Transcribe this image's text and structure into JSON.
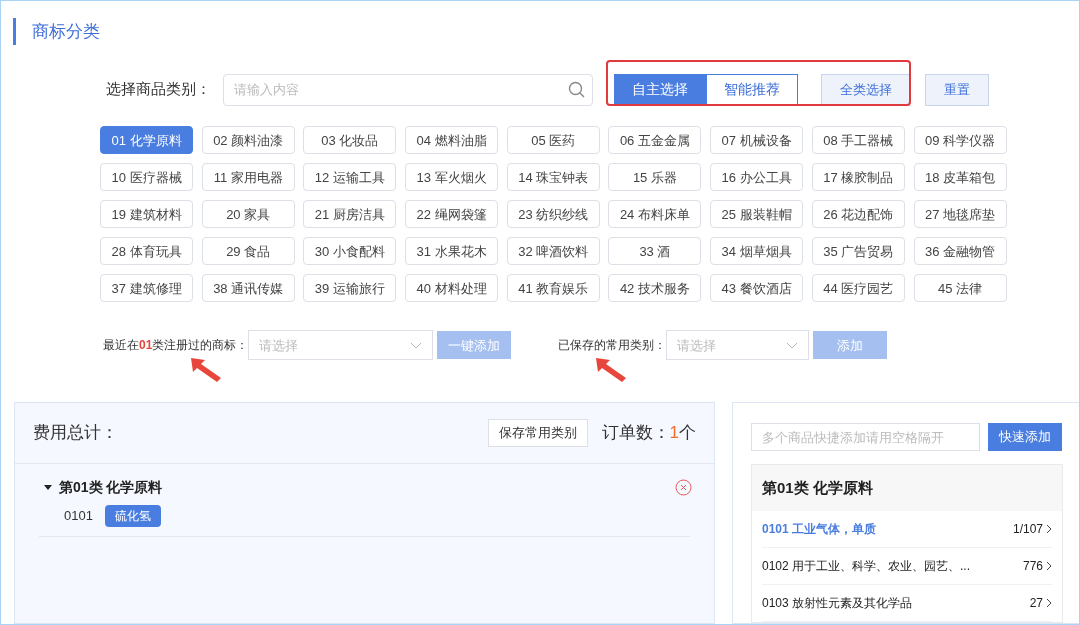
{
  "title": "商标分类",
  "search": {
    "label": "选择商品类别：",
    "placeholder": "请输入内容"
  },
  "modes": [
    {
      "label": "自主选择",
      "selected": true
    },
    {
      "label": "智能推荐",
      "selected": false
    }
  ],
  "actions": [
    "全类选择",
    "重置"
  ],
  "categories": [
    {
      "label": "01 化学原料",
      "selected": true
    },
    {
      "label": "02 颜料油漆",
      "selected": false
    },
    {
      "label": "03 化妆品",
      "selected": false
    },
    {
      "label": "04 燃料油脂",
      "selected": false
    },
    {
      "label": "05 医药",
      "selected": false
    },
    {
      "label": "06 五金金属",
      "selected": false
    },
    {
      "label": "07 机械设备",
      "selected": false
    },
    {
      "label": "08 手工器械",
      "selected": false
    },
    {
      "label": "09 科学仪器",
      "selected": false
    },
    {
      "label": "10 医疗器械",
      "selected": false
    },
    {
      "label": "11 家用电器",
      "selected": false
    },
    {
      "label": "12 运输工具",
      "selected": false
    },
    {
      "label": "13 军火烟火",
      "selected": false
    },
    {
      "label": "14 珠宝钟表",
      "selected": false
    },
    {
      "label": "15 乐器",
      "selected": false
    },
    {
      "label": "16 办公工具",
      "selected": false
    },
    {
      "label": "17 橡胶制品",
      "selected": false
    },
    {
      "label": "18 皮革箱包",
      "selected": false
    },
    {
      "label": "19 建筑材料",
      "selected": false
    },
    {
      "label": "20 家具",
      "selected": false
    },
    {
      "label": "21 厨房洁具",
      "selected": false
    },
    {
      "label": "22 绳网袋篷",
      "selected": false
    },
    {
      "label": "23 纺织纱线",
      "selected": false
    },
    {
      "label": "24 布料床单",
      "selected": false
    },
    {
      "label": "25 服装鞋帽",
      "selected": false
    },
    {
      "label": "26 花边配饰",
      "selected": false
    },
    {
      "label": "27 地毯席垫",
      "selected": false
    },
    {
      "label": "28 体育玩具",
      "selected": false
    },
    {
      "label": "29 食品",
      "selected": false
    },
    {
      "label": "30 小食配料",
      "selected": false
    },
    {
      "label": "31 水果花木",
      "selected": false
    },
    {
      "label": "32 啤酒饮料",
      "selected": false
    },
    {
      "label": "33 酒",
      "selected": false
    },
    {
      "label": "34 烟草烟具",
      "selected": false
    },
    {
      "label": "35 广告贸易",
      "selected": false
    },
    {
      "label": "36 金融物管",
      "selected": false
    },
    {
      "label": "37 建筑修理",
      "selected": false
    },
    {
      "label": "38 通讯传媒",
      "selected": false
    },
    {
      "label": "39 运输旅行",
      "selected": false
    },
    {
      "label": "40 材料处理",
      "selected": false
    },
    {
      "label": "41 教育娱乐",
      "selected": false
    },
    {
      "label": "42 技术服务",
      "selected": false
    },
    {
      "label": "43 餐饮酒店",
      "selected": false
    },
    {
      "label": "44 医疗园艺",
      "selected": false
    },
    {
      "label": "45 法律",
      "selected": false
    }
  ],
  "pickers": [
    {
      "label": "最近在**01**类注册过的商标：",
      "placeholder": "请选择",
      "button": "一键添加"
    },
    {
      "label": "已保存的常用类别：",
      "placeholder": "请选择",
      "button": "添加"
    }
  ],
  "summary": {
    "title": "费用总计：",
    "save_button": "保存常用类别",
    "order_count": "订单数：**1**个",
    "groups": [
      {
        "title": "第01类 化学原料",
        "expanded": true,
        "items": [
          {
            "code": "0101",
            "tags": [
              "硫化氢"
            ]
          }
        ]
      }
    ]
  },
  "quick_add": {
    "placeholder": "多个商品快捷添加请用空格隔开",
    "button": "快速添加"
  },
  "subclass_panel": {
    "title": "第01类 化学原料",
    "items": [
      {
        "label": "0101 工业气体，单质",
        "count": "1/107",
        "selected": true
      },
      {
        "label": "0102 用于工业、科学、农业、园艺、...",
        "count": "776",
        "selected": false
      },
      {
        "label": "0103 放射性元素及其化学品",
        "count": "27",
        "selected": false
      }
    ]
  }
}
